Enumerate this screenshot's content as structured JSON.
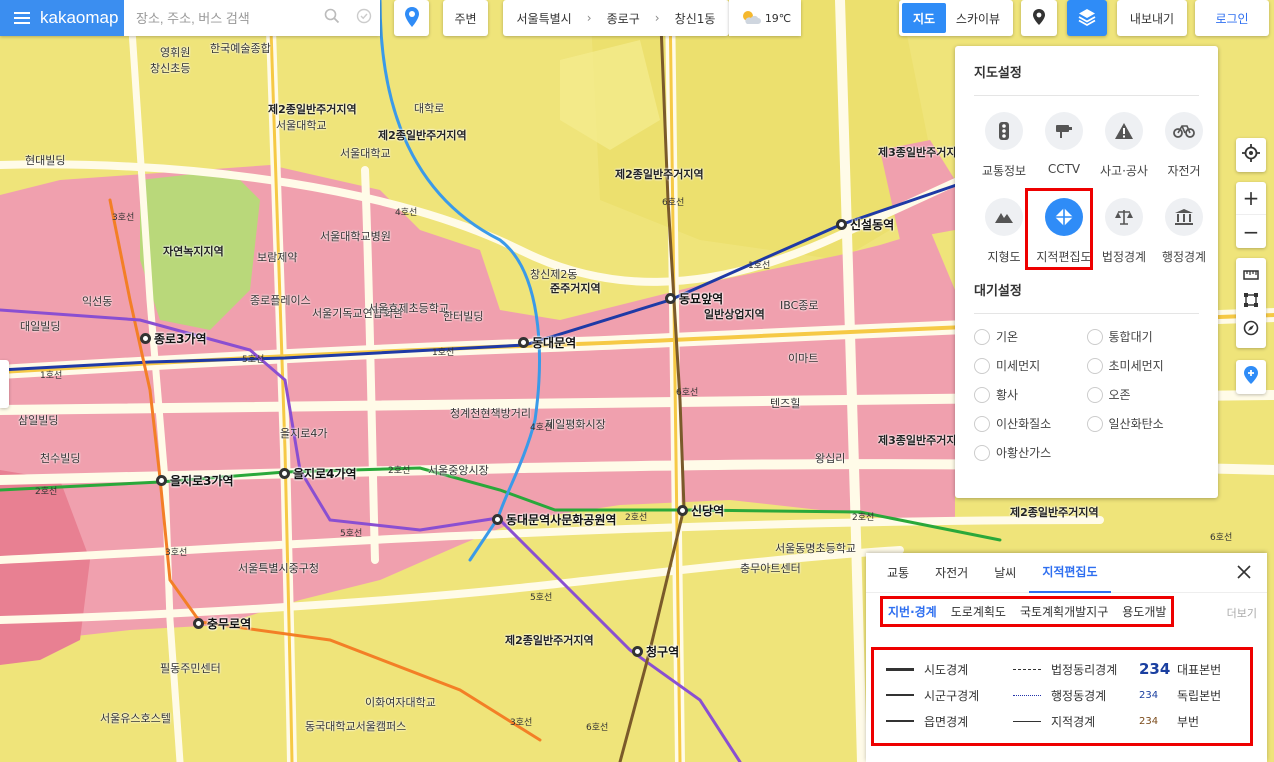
{
  "topbar": {
    "logo": "kakaomap",
    "search_placeholder": "장소, 주소, 버스 검색",
    "nearby": "주변",
    "breadcrumb": [
      "서울특별시",
      "종로구",
      "창신1동"
    ],
    "temperature": "19℃"
  },
  "map_controls": {
    "map": "지도",
    "skyview": "스카이뷰",
    "export": "내보내기",
    "login": "로그인"
  },
  "settings": {
    "map_title": "지도설정",
    "items": [
      {
        "label": "교통정보",
        "icon": "traffic-light-icon"
      },
      {
        "label": "CCTV",
        "icon": "cctv-icon"
      },
      {
        "label": "사고·공사",
        "icon": "warning-icon"
      },
      {
        "label": "자전거",
        "icon": "bicycle-icon"
      },
      {
        "label": "지형도",
        "icon": "mountain-icon"
      },
      {
        "label": "지적편집도",
        "icon": "cadastral-icon",
        "active": true
      },
      {
        "label": "법정경계",
        "icon": "scale-icon"
      },
      {
        "label": "행정경계",
        "icon": "government-icon"
      }
    ],
    "air_title": "대기설정",
    "air": [
      "기온",
      "통합대기",
      "미세먼지",
      "초미세먼지",
      "황사",
      "오존",
      "이산화질소",
      "일산화탄소",
      "아황산가스"
    ]
  },
  "legend": {
    "tabs": [
      "교통",
      "자전거",
      "날씨",
      "지적편집도"
    ],
    "active_tab": "지적편집도",
    "subtabs": [
      "지번·경계",
      "도로계획도",
      "국토계획개발지구",
      "용도개발"
    ],
    "more": "더보기",
    "rows": [
      [
        "시도경계",
        "법정동리경계",
        "234",
        "대표본번"
      ],
      [
        "시군구경계",
        "행정동경계",
        "234",
        "독립본번"
      ],
      [
        "읍면경계",
        "지적경계",
        "234",
        "부번"
      ]
    ]
  },
  "map": {
    "stations": [
      "종로3가역",
      "동대문역",
      "동묘앞역",
      "신설동역",
      "을지로3가역",
      "을지로4가역",
      "동대문역사문화공원역",
      "신당역",
      "충무로역",
      "청구역"
    ],
    "zones": [
      "제2종일반주거지역",
      "제2종일반주거지역",
      "제2종일반주거지역",
      "자연녹지지역",
      "준주거지역",
      "일반상업지역",
      "제3종일반주거지역",
      "제2종일반주거지역",
      "제2종일반주거지역",
      "제3종일반주거지역",
      "일반상업지역"
    ],
    "labels": [
      "영휘원",
      "창신초등",
      "한국예술종합",
      "서울대학교",
      "서울대학교",
      "대학로",
      "서울대학교병원",
      "현대빌딩",
      "익선동",
      "대일빌딩",
      "삼일빌딩",
      "천수빌딩",
      "종로플레이스",
      "보람제약",
      "서울기독교연합회관",
      "서울효제초등학교",
      "한터빌딩",
      "창신제2동",
      "청계천현책방거리",
      "제일평화시장",
      "서울중앙시장",
      "을지로4가",
      "서울특별시중구청",
      "충무아트센터",
      "서울동명초등학교",
      "IBC종로",
      "이마트",
      "텐즈힐",
      "왕십리",
      "서울유스호스텔",
      "필동주민센터",
      "동국대학교서울캠퍼스",
      "이화여자대학교"
    ],
    "lanes": [
      "1호선",
      "1호선",
      "1호선",
      "2호선",
      "2호선",
      "2호선",
      "2호선",
      "3호선",
      "3호선",
      "3호선",
      "4호선",
      "4호선",
      "5호선",
      "5호선",
      "5호선",
      "6호선",
      "6호선",
      "6호선",
      "6호선"
    ]
  }
}
